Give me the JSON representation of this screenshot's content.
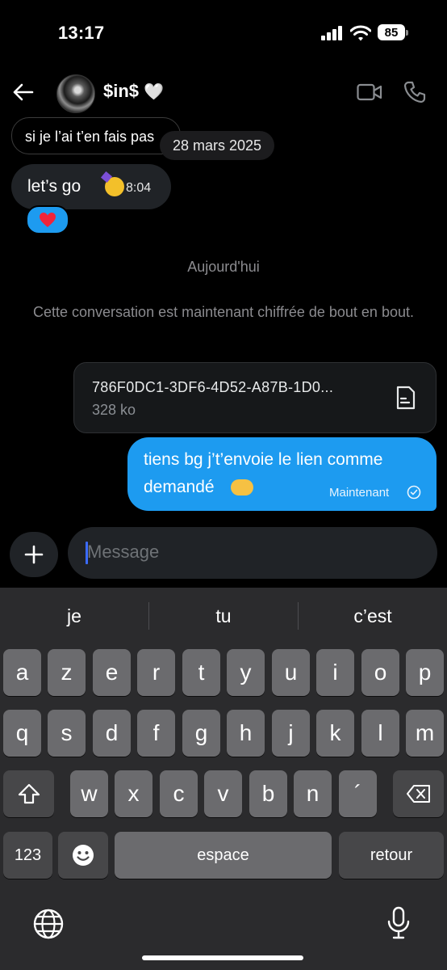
{
  "status_bar": {
    "time": "13:17",
    "battery": "85"
  },
  "header": {
    "contact_name": "$in$",
    "contact_emoji": "🤍"
  },
  "messages": {
    "partial_incoming_text": "si je l’ai t’en fais pas",
    "date_pill": "28 mars 2025",
    "incoming": {
      "text": "let’s go",
      "emoji": "🥳",
      "time": "8:04",
      "reaction": "❤️"
    },
    "day_separator": "Aujourd'hui",
    "encryption_note": "Cette conversation est maintenant chiffrée de bout en bout.",
    "file": {
      "name": "786F0DC1-3DF6-4D52-A87B-1D0...",
      "size": "328 ko"
    },
    "outgoing": {
      "line1": "tiens bg j’t’envoie le lien comme",
      "line2": "demandé",
      "emoji": "🤝",
      "status": "Maintenant"
    }
  },
  "composer": {
    "placeholder": "Message",
    "plus_label": "+"
  },
  "keyboard": {
    "suggestions": [
      "je",
      "tu",
      "c’est"
    ],
    "row1": [
      "a",
      "z",
      "e",
      "r",
      "t",
      "y",
      "u",
      "i",
      "o",
      "p"
    ],
    "row2": [
      "q",
      "s",
      "d",
      "f",
      "g",
      "h",
      "j",
      "k",
      "l",
      "m"
    ],
    "row3": [
      "w",
      "x",
      "c",
      "v",
      "b",
      "n",
      "´"
    ],
    "numbers_label": "123",
    "space_label": "espace",
    "return_label": "retour"
  },
  "colors": {
    "accent": "#1d9bf0",
    "background": "#000000",
    "key": "#6b6b6e",
    "key_dark": "#474749"
  }
}
